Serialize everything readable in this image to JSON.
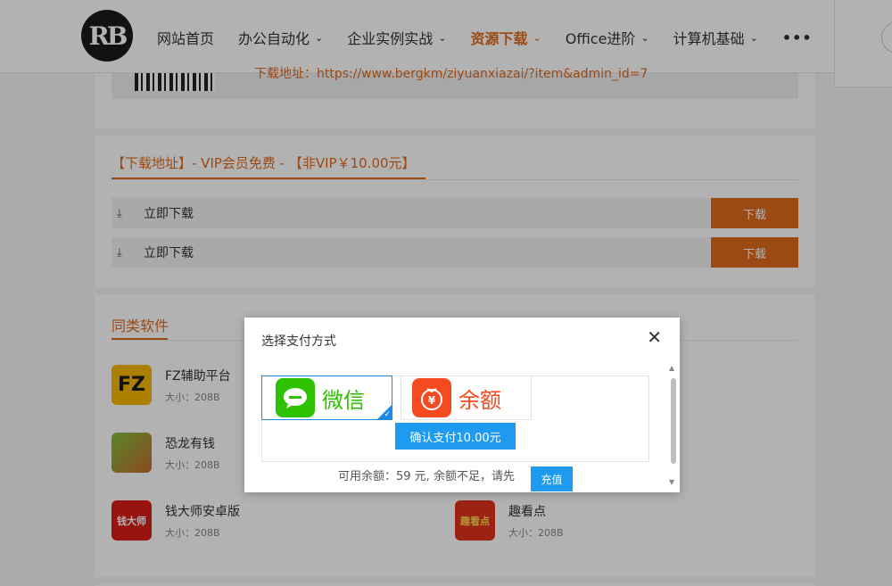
{
  "header": {
    "logo_text": "RB",
    "nav": [
      {
        "label": "网站首页",
        "has_dropdown": false,
        "active": false
      },
      {
        "label": "办公自动化",
        "has_dropdown": true,
        "active": false
      },
      {
        "label": "企业实例实战",
        "has_dropdown": true,
        "active": false
      },
      {
        "label": "资源下载",
        "has_dropdown": true,
        "active": true
      },
      {
        "label": "Office进阶",
        "has_dropdown": true,
        "active": false
      },
      {
        "label": "计算机基础",
        "has_dropdown": true,
        "active": false
      }
    ],
    "more": "•••"
  },
  "qr": {
    "link_text": "下载地址：https://www.bergkm/ziyuanxiazai/?item&admin_id=7"
  },
  "download": {
    "title": "【下载地址】- VIP会员免费 - 【非VIP￥10.00元】",
    "rows": [
      {
        "label": "立即下载",
        "button": "下载"
      },
      {
        "label": "立即下载",
        "button": "下载"
      }
    ]
  },
  "similar": {
    "title": "同类软件",
    "apps": [
      {
        "name": "FZ辅助平台",
        "size": "大小：208B",
        "icon_text": "FZ",
        "icon_bg": "#f5b800",
        "icon_color": "#1a1a1a"
      },
      {
        "name": "恐龙有钱",
        "size": "大小：208B",
        "icon_text": "",
        "icon_bg": "#c96a2c",
        "icon_color": "#fff"
      },
      {
        "name": "钱大师安卓版",
        "size": "大小：208B",
        "icon_text": "钱大师",
        "icon_bg": "#d91e18",
        "icon_color": "#fff"
      },
      {
        "name": "趣看点",
        "size": "大小：208B",
        "icon_text": "趣看点",
        "icon_bg": "#e0331c",
        "icon_color": "#ffd84d"
      }
    ]
  },
  "modal": {
    "title": "选择支付方式",
    "close": "✕",
    "options": [
      {
        "label": "微信",
        "selected": true,
        "color": "#2dc100",
        "icon": "wechat-icon"
      },
      {
        "label": "余额",
        "selected": false,
        "color": "#f44a1f",
        "icon": "money-bag-icon"
      }
    ],
    "confirm_button": "确认支付10.00元",
    "balance_text": "可用余额：59 元, 余额不足，请先",
    "recharge_button": "充值"
  },
  "colors": {
    "accent": "#e06b1e",
    "blue": "#1e9bf0"
  }
}
